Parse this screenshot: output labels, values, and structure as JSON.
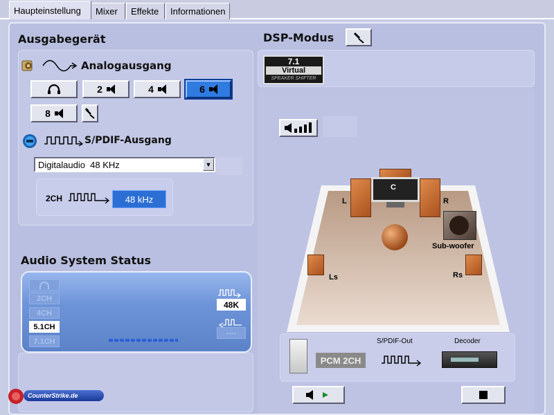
{
  "tabs": [
    "Haupteinstellung",
    "Mixer",
    "Effekte",
    "Informationen"
  ],
  "output": {
    "title": "Ausgabegerät",
    "analog_label": "Analogausgang",
    "channel_buttons": [
      "2",
      "4",
      "6",
      "8"
    ],
    "selected_channels": "6",
    "spdif_label": "S/PDIF-Ausgang",
    "spdif_select_value": "Digitalaudio  48 KHz",
    "spdif_info_label": "2CH",
    "spdif_rate": "48 kHz"
  },
  "status": {
    "title": "Audio System Status",
    "channels": [
      "2CH",
      "4CH",
      "5.1CH",
      "7.1CH"
    ],
    "active_channel": "5.1CH",
    "rate": "48K",
    "input_placeholder": "----"
  },
  "dsp": {
    "title": "DSP-Modus",
    "virtual_badge_top": "7.1",
    "virtual_badge_mid": "Virtual",
    "virtual_badge_bottom": "SPEAKER SHIFTER",
    "speakers": {
      "center": "C",
      "left": "L",
      "right": "R",
      "subwoofer": "Sub-woofer",
      "left_surround": "Ls",
      "right_surround": "Rs"
    },
    "pcm_label": "PCM 2CH",
    "spdif_out_label": "S/PDIF-Out",
    "decoder_label": "Decoder"
  },
  "watermark": "CounterStrike.de",
  "colors": {
    "accent": "#2f7be0",
    "panel": "#b9bfe0",
    "status_bg": "#6d94d8"
  }
}
